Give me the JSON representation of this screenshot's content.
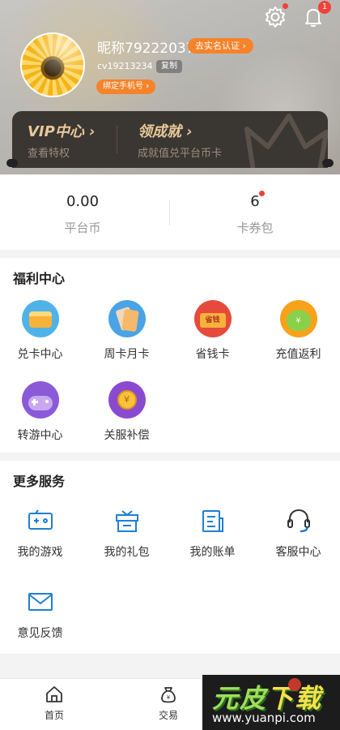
{
  "header": {
    "nickname": "昵称79222037",
    "verify_label": "去实名认证 ›",
    "cv_id": "cv19213234",
    "copy_label": "复制",
    "bind_phone_label": "绑定手机号 ›",
    "notification_count": "1",
    "accent_color": "#f5832a"
  },
  "vip": {
    "title": "VIP中心 ›",
    "subtitle": "查看特权",
    "achievement_title": "领成就 ›",
    "achievement_subtitle": "成就值兑平台币卡"
  },
  "wallet": {
    "coin_value": "0.00",
    "coin_label": "平台币",
    "coupon_value": "6",
    "coupon_label": "卡券包"
  },
  "welfare": {
    "title": "福利中心",
    "items": [
      {
        "label": "兑卡中心",
        "icon": "exchange-card-icon"
      },
      {
        "label": "周卡月卡",
        "icon": "weekly-card-icon"
      },
      {
        "label": "省钱卡",
        "icon": "save-money-card-icon"
      },
      {
        "label": "充值返利",
        "icon": "recharge-rebate-icon"
      },
      {
        "label": "转游中心",
        "icon": "game-transfer-icon"
      },
      {
        "label": "关服补偿",
        "icon": "compensation-icon"
      }
    ],
    "save_card_text": "省钱"
  },
  "more": {
    "title": "更多服务",
    "items": [
      {
        "label": "我的游戏",
        "icon": "gamepad-icon"
      },
      {
        "label": "我的礼包",
        "icon": "gift-icon"
      },
      {
        "label": "我的账单",
        "icon": "bill-icon"
      },
      {
        "label": "客服中心",
        "icon": "headset-icon"
      },
      {
        "label": "意见反馈",
        "icon": "mail-icon"
      }
    ]
  },
  "tabs": [
    {
      "label": "首页",
      "icon": "home-icon"
    },
    {
      "label": "交易",
      "icon": "money-bag-icon"
    }
  ],
  "watermark": {
    "title_part1": "元皮",
    "title_part2": "下载",
    "url": "www.yuanpi.com"
  }
}
